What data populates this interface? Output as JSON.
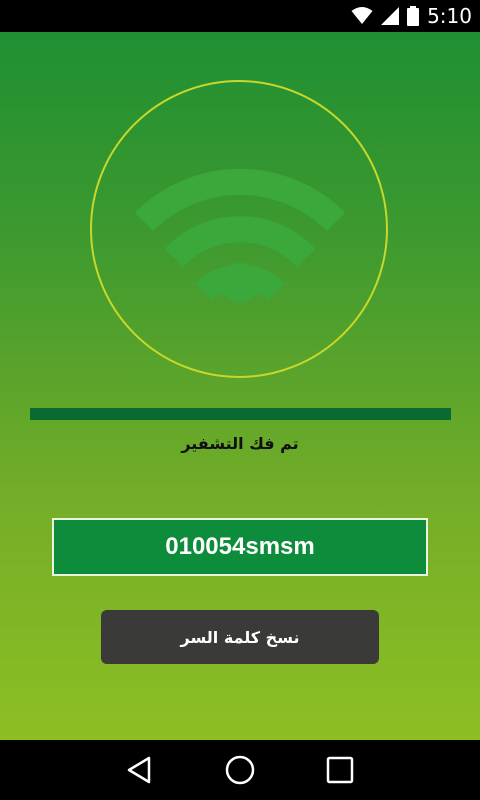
{
  "status_bar": {
    "time": "5:10",
    "icons": [
      "wifi-signal-icon",
      "cell-signal-icon",
      "battery-icon"
    ]
  },
  "main": {
    "wifi_icon": "wifi-icon",
    "progress_percent": 100,
    "status_text": "تم فك التشفير",
    "password": "010054smsm",
    "copy_button_label": "نسخ كلمة السر"
  },
  "nav_bar": {
    "buttons": [
      "back-icon",
      "home-icon",
      "recents-icon"
    ]
  },
  "colors": {
    "ring": "#c7d82a",
    "wifi": "#3aa83a",
    "progress": "#0a6b32",
    "password_bg": "#0d8c3b",
    "button_bg": "#3a3a38"
  }
}
